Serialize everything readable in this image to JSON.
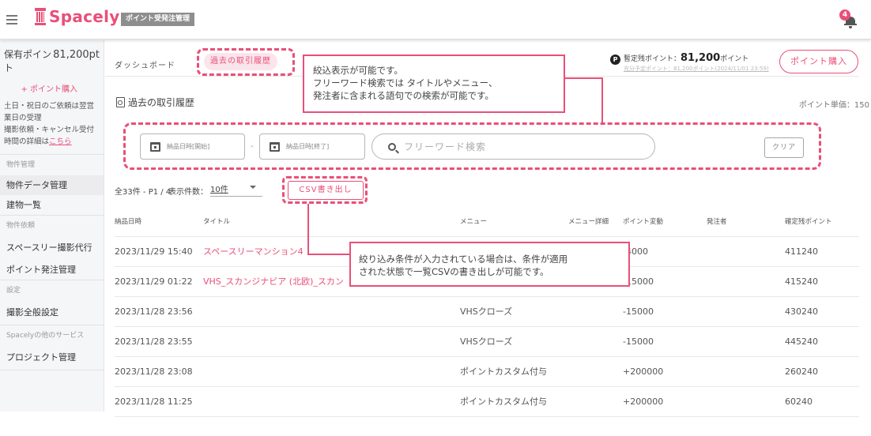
{
  "header": {
    "logo_text": "Spacely",
    "app_badge": "ポイント受発注管理",
    "notification_count": "4"
  },
  "sidebar": {
    "points_label": "保有ポイント",
    "points_value": "81,200pt",
    "buy_points_link": "+ ポイント購入",
    "notice_lines": [
      "土日・祝日のご依頼は翌営業日の受理",
      "撮影依頼・キャンセル受付時間の詳細は"
    ],
    "notice_link": "こちら",
    "groups": [
      {
        "heading": "物件管理",
        "items": [
          {
            "label": "物件データ管理",
            "active": true
          },
          {
            "label": "建物一覧",
            "active": false
          }
        ]
      },
      {
        "heading": "物件依頼",
        "items": [
          {
            "label": "スペースリー撮影代行",
            "active": false
          },
          {
            "label": "ポイント発注管理",
            "active": false
          }
        ]
      },
      {
        "heading": "設定",
        "items": [
          {
            "label": "撮影全般設定",
            "active": false
          }
        ]
      },
      {
        "heading": "Spacelyの他のサービス",
        "items": [
          {
            "label": "プロジェクト管理",
            "active": false
          }
        ]
      }
    ]
  },
  "subheader": {
    "tab_dashboard": "ダッシュボード",
    "tab_history": "過去の取引履歴",
    "balance_badge": "P",
    "balance_label": "暫定残ポイント：",
    "balance_value": "81,200",
    "balance_unit": "ポイント",
    "expected_line": "充分予定ポイント：81,200ポイント(2024/11/01 23:59)",
    "buy_button": "ポイント購入"
  },
  "main": {
    "page_title": "過去の取引履歴",
    "unit_price": "ポイント単価：150",
    "filter": {
      "date_start_placeholder": "納品日時[開始]",
      "date_separator": "-",
      "date_end_placeholder": "納品日時[終了]",
      "search_placeholder": "フリーワード検索",
      "clear_button": "クリア"
    },
    "count_text": "全33件 - P1 / 4",
    "per_page_label": "表示件数：",
    "per_page_value": "10件",
    "csv_button": "CSV書き出し"
  },
  "table": {
    "columns": [
      "納品日時",
      "タイトル",
      "メニュー",
      "メニュー詳細",
      "ポイント変動",
      "発注者",
      "確定残ポイント"
    ],
    "rows": [
      {
        "date": "2023/11/29 15:40",
        "title": "スペースリーマンション4",
        "menu": "",
        "detail": "",
        "change": "-4000",
        "orderer": "",
        "balance": "411240"
      },
      {
        "date": "2023/11/29 01:22",
        "title": "VHS_スカンジナビア (北欧)_スカン",
        "menu": "",
        "detail": "",
        "change": "-15000",
        "orderer": "",
        "balance": "415240"
      },
      {
        "date": "2023/11/28 23:56",
        "title": "",
        "menu": "VHSクローズ",
        "detail": "",
        "change": "-15000",
        "orderer": "",
        "balance": "430240"
      },
      {
        "date": "2023/11/28 23:55",
        "title": "",
        "menu": "VHSクローズ",
        "detail": "",
        "change": "-15000",
        "orderer": "",
        "balance": "445240"
      },
      {
        "date": "2023/11/28 23:08",
        "title": "",
        "menu": "ポイントカスタム付与",
        "detail": "",
        "change": "+200000",
        "orderer": "",
        "balance": "260240"
      },
      {
        "date": "2023/11/28 11:25",
        "title": "",
        "menu": "ポイントカスタム付与",
        "detail": "",
        "change": "+200000",
        "orderer": "",
        "balance": "60240"
      }
    ]
  },
  "annotations": {
    "filter_note": [
      "絞込表示が可能です。",
      "フリーワード検索では タイトルやメニュー、",
      "発注者に含まれる語句での検索が可能です。"
    ],
    "csv_note": [
      "絞り込み条件が入力されている場合は、条件が適用",
      "された状態で一覧CSVの書き出しが可能です。"
    ]
  },
  "colors": {
    "accent": "#e94f78",
    "badge_gray": "#8e8e8e",
    "sidebar_bg": "#f5f6f8"
  }
}
